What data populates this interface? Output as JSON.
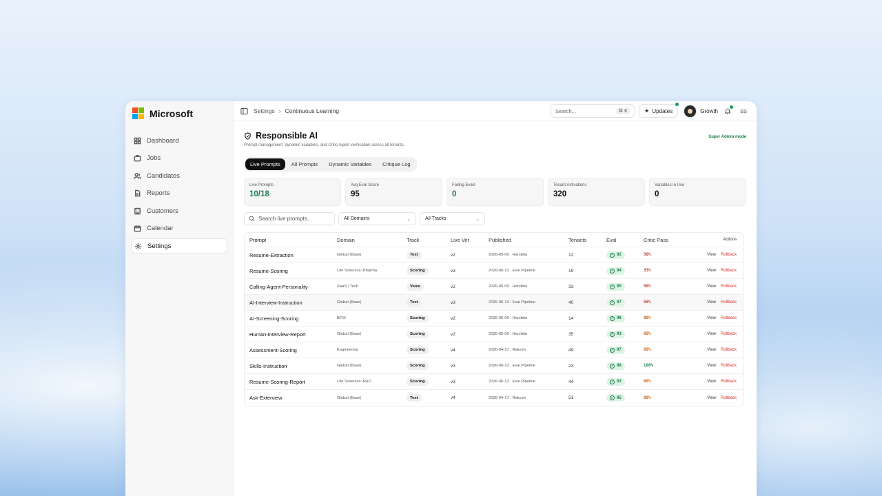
{
  "brand": {
    "name": "Microsoft",
    "logo_colors": [
      "#f25022",
      "#7fba00",
      "#00a4ef",
      "#ffb900"
    ]
  },
  "sidebar": {
    "items": [
      {
        "label": "Dashboard",
        "icon": "grid-icon"
      },
      {
        "label": "Jobs",
        "icon": "briefcase-icon"
      },
      {
        "label": "Candidates",
        "icon": "users-icon"
      },
      {
        "label": "Reports",
        "icon": "file-icon"
      },
      {
        "label": "Customers",
        "icon": "building-icon"
      },
      {
        "label": "Calendar",
        "icon": "calendar-icon"
      },
      {
        "label": "Settings",
        "icon": "gear-icon",
        "active": true
      }
    ]
  },
  "topbar": {
    "breadcrumb": [
      "Settings",
      "Continuous Learning"
    ],
    "search_placeholder": "Search...",
    "search_shortcut": "⌘ K",
    "updates_label": "Updates",
    "workspace_label": "Growth",
    "user_initials": "SS"
  },
  "page": {
    "title": "Responsible AI",
    "subtitle": "Prompt management, dynamic variables, and Critic Agent verification across all tenants.",
    "mode_label": "Super Admin mode"
  },
  "tabs": [
    {
      "label": "Live Prompts",
      "active": true
    },
    {
      "label": "All Prompts"
    },
    {
      "label": "Dynamic Variables"
    },
    {
      "label": "Critique Log"
    }
  ],
  "stats": [
    {
      "label": "Live Prompts",
      "value": "10/18",
      "green": true
    },
    {
      "label": "Avg Eval Score",
      "value": "95"
    },
    {
      "label": "Failing Evals",
      "value": "0",
      "green": true
    },
    {
      "label": "Tenant Activations",
      "value": "320"
    },
    {
      "label": "Variables in Use",
      "value": "0"
    }
  ],
  "filters": {
    "search_placeholder": "Search live prompts...",
    "domain_value": "All Domains",
    "track_value": "All Tracks"
  },
  "table": {
    "headers": [
      "Prompt",
      "Domain",
      "Track",
      "Live Ver",
      "Published",
      "Tenants",
      "Eval",
      "Critic Pass",
      "Actions"
    ],
    "rows": [
      {
        "prompt": "Resume-Extraction",
        "domain": "Global (Base)",
        "track": "Text",
        "ver": "v2",
        "published": "2026-05-09 . Harshita",
        "tenants": "12",
        "eval": "92",
        "critic": "50%",
        "critic_color": "#c0392b"
      },
      {
        "prompt": "Resume-Scoring",
        "domain": "Life Sciences: Pharma",
        "track": "Scoring",
        "ver": "v3",
        "published": "2026-06-13 . Eval Pipeline",
        "tenants": "19",
        "eval": "94",
        "critic": "33%",
        "critic_color": "#c0392b"
      },
      {
        "prompt": "Calling-Agent-Personality",
        "domain": "SaaS / Tech",
        "track": "Voice",
        "ver": "v2",
        "published": "2026-05-09 . Harshita",
        "tenants": "33",
        "eval": "90",
        "critic": "50%",
        "critic_color": "#c0392b"
      },
      {
        "prompt": "AI-Interview-Instruction",
        "domain": "Global (Base)",
        "track": "Text",
        "ver": "v3",
        "published": "2026-06-13 . Eval Pipeline",
        "tenants": "40",
        "eval": "97",
        "critic": "50%",
        "critic_color": "#c0392b",
        "shade": true
      },
      {
        "prompt": "AI-Screening-Scoring",
        "domain": "BFSI",
        "track": "Scoring",
        "ver": "v2",
        "published": "2026-05-09 . Harshita",
        "tenants": "14",
        "eval": "98",
        "critic": "80%",
        "critic_color": "#c2611a"
      },
      {
        "prompt": "Human-Interview-Report",
        "domain": "Global (Base)",
        "track": "Scoring",
        "ver": "v2",
        "published": "2026-05-09 . Harshita",
        "tenants": "35",
        "eval": "93",
        "critic": "60%",
        "critic_color": "#c2611a"
      },
      {
        "prompt": "Assessment-Scoring",
        "domain": "Engineering",
        "track": "Scoring",
        "ver": "v4",
        "published": "2026-04-17 . Rakesh",
        "tenants": "49",
        "eval": "97",
        "critic": "60%",
        "critic_color": "#c2611a"
      },
      {
        "prompt": "Skills-Instruction",
        "domain": "Global (Base)",
        "track": "Scoring",
        "ver": "v3",
        "published": "2026-06-13 . Eval Pipeline",
        "tenants": "23",
        "eval": "98",
        "critic": "100%",
        "critic_color": "#1a7f46"
      },
      {
        "prompt": "Resume-Scoring-Report",
        "domain": "Life Sciences: R&D",
        "track": "Scoring",
        "ver": "v3",
        "published": "2026-06-13 . Eval Pipeline",
        "tenants": "44",
        "eval": "93",
        "critic": "60%",
        "critic_color": "#c2611a"
      },
      {
        "prompt": "Ask-Exterview",
        "domain": "Global (Base)",
        "track": "Text",
        "ver": "v4",
        "published": "2026-04-17 . Rakesh",
        "tenants": "51",
        "eval": "95",
        "critic": "80%",
        "critic_color": "#c2611a"
      }
    ],
    "action_view": "View",
    "action_rollback": "Rollback"
  }
}
